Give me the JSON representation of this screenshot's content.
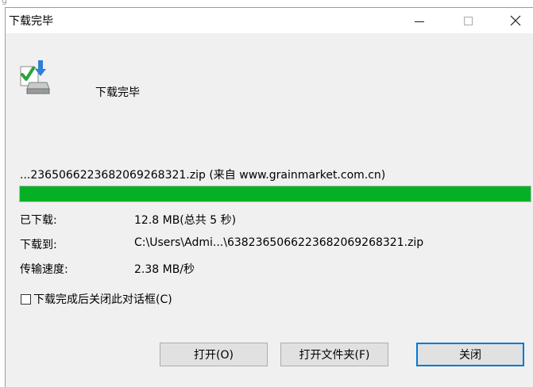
{
  "window": {
    "title": "下载完毕",
    "minimize_icon": "minimize-icon",
    "maximize_icon": "maximize-icon",
    "close_icon": "close-icon",
    "close_glyph": "✕"
  },
  "header": {
    "icon": "download-complete-icon",
    "label": "下载完毕"
  },
  "download": {
    "file_line": "...2365066223682069268321.zip (来自 www.grainmarket.com.cn)",
    "progress_fraction": 1.0,
    "progress_color": "#06b025",
    "rows": [
      {
        "label": "已下载:",
        "value": "12.8 MB(总共 5 秒)"
      },
      {
        "label": "下载到:",
        "value": "C:\\Users\\Admi...\\638236506622368206926832​1.zip"
      },
      {
        "label": "传输速度:",
        "value": "2.38 MB/秒"
      }
    ]
  },
  "option": {
    "checked": false,
    "label": "下载完成后关闭此对话框(C)"
  },
  "buttons": {
    "open": "打开(O)",
    "open_folder": "打开文件夹(F)",
    "close": "关闭"
  },
  "colors": {
    "focus_border": "#0078d7",
    "dialog_bg": "#f0f0f0"
  }
}
